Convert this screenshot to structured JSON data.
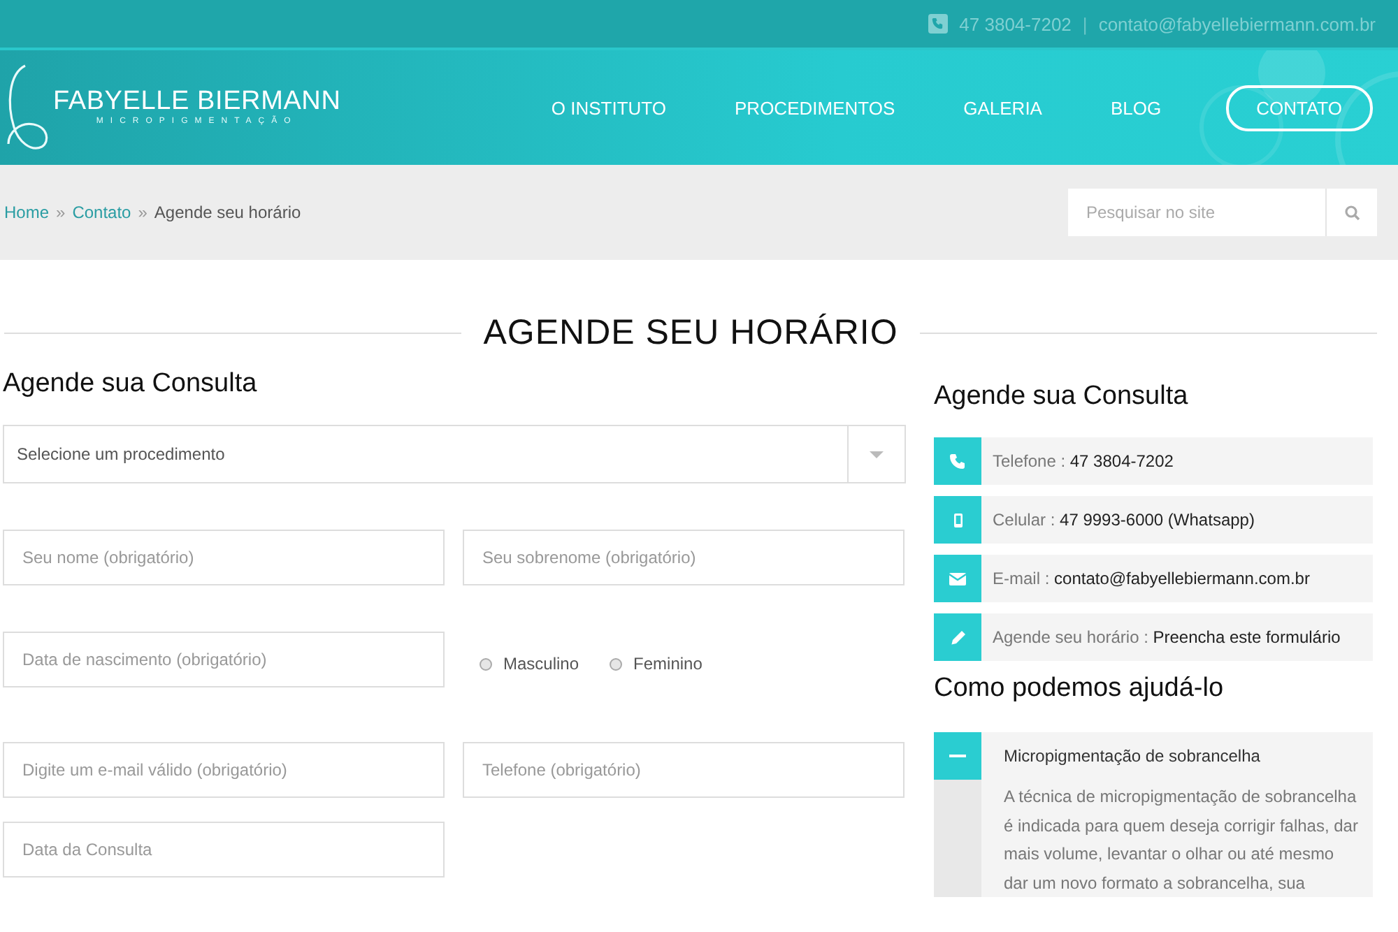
{
  "topbar": {
    "phone": "47 3804-7202",
    "separator": "|",
    "email": "contato@fabyellebiermann.com.br"
  },
  "logo": {
    "name": "FABYELLE BIERMANN",
    "tagline": "MICROPIGMENTAÇÃO"
  },
  "nav": [
    {
      "label": "O INSTITUTO",
      "selected": false
    },
    {
      "label": "PROCEDIMENTOS",
      "selected": false
    },
    {
      "label": "GALERIA",
      "selected": false
    },
    {
      "label": "BLOG",
      "selected": false
    },
    {
      "label": "CONTATO",
      "selected": true
    }
  ],
  "breadcrumb": [
    {
      "label": "Home",
      "link": true
    },
    {
      "label": "Contato",
      "link": true
    },
    {
      "label": "Agende seu horário",
      "link": false
    }
  ],
  "breadcrumb_separator": "»",
  "search": {
    "placeholder": "Pesquisar no site"
  },
  "page_title": "AGENDE SEU HORÁRIO",
  "form": {
    "title": "Agende sua Consulta",
    "select": {
      "placeholder": "Selecione um procedimento"
    },
    "rows": [
      [
        {
          "kind": "text",
          "placeholder": "Seu nome (obrigatório)"
        },
        {
          "kind": "text",
          "placeholder": "Seu sobrenome (obrigatório)"
        }
      ],
      [
        {
          "kind": "text",
          "placeholder": "Data de nascimento (obrigatório)"
        },
        {
          "kind": "radios",
          "options": [
            {
              "label": "Masculino",
              "selected": false
            },
            {
              "label": "Feminino",
              "selected": false
            }
          ]
        }
      ],
      [
        {
          "kind": "text",
          "placeholder": "Digite um e-mail válido (obrigatório)"
        },
        {
          "kind": "text",
          "placeholder": "Telefone (obrigatório)"
        }
      ],
      [
        {
          "kind": "text",
          "placeholder": "Data da Consulta"
        }
      ]
    ]
  },
  "sidebar": {
    "title": "Agende sua Consulta",
    "contacts": [
      {
        "kind": "phone",
        "label": "Telefone :",
        "value": "47 3804-7202"
      },
      {
        "kind": "mobile",
        "label": "Celular :",
        "value": "47 9993-6000 (Whatsapp)"
      },
      {
        "kind": "email",
        "label": "E-mail :",
        "value": "contato@fabyellebiermann.com.br"
      },
      {
        "kind": "pencil",
        "label": "Agende seu horário :",
        "value": "Preencha este formulário"
      }
    ],
    "help_title": "Como podemos ajudá-lo",
    "accordion": [
      {
        "title": "Micropigmentação de sobrancelha",
        "expanded": true,
        "body": "A técnica de micropigmentação de sobrancelha é indicada para quem deseja corrigir falhas, dar mais volume, levantar o olhar ou até mesmo dar um novo formato a sobrancelha, sua"
      }
    ]
  }
}
